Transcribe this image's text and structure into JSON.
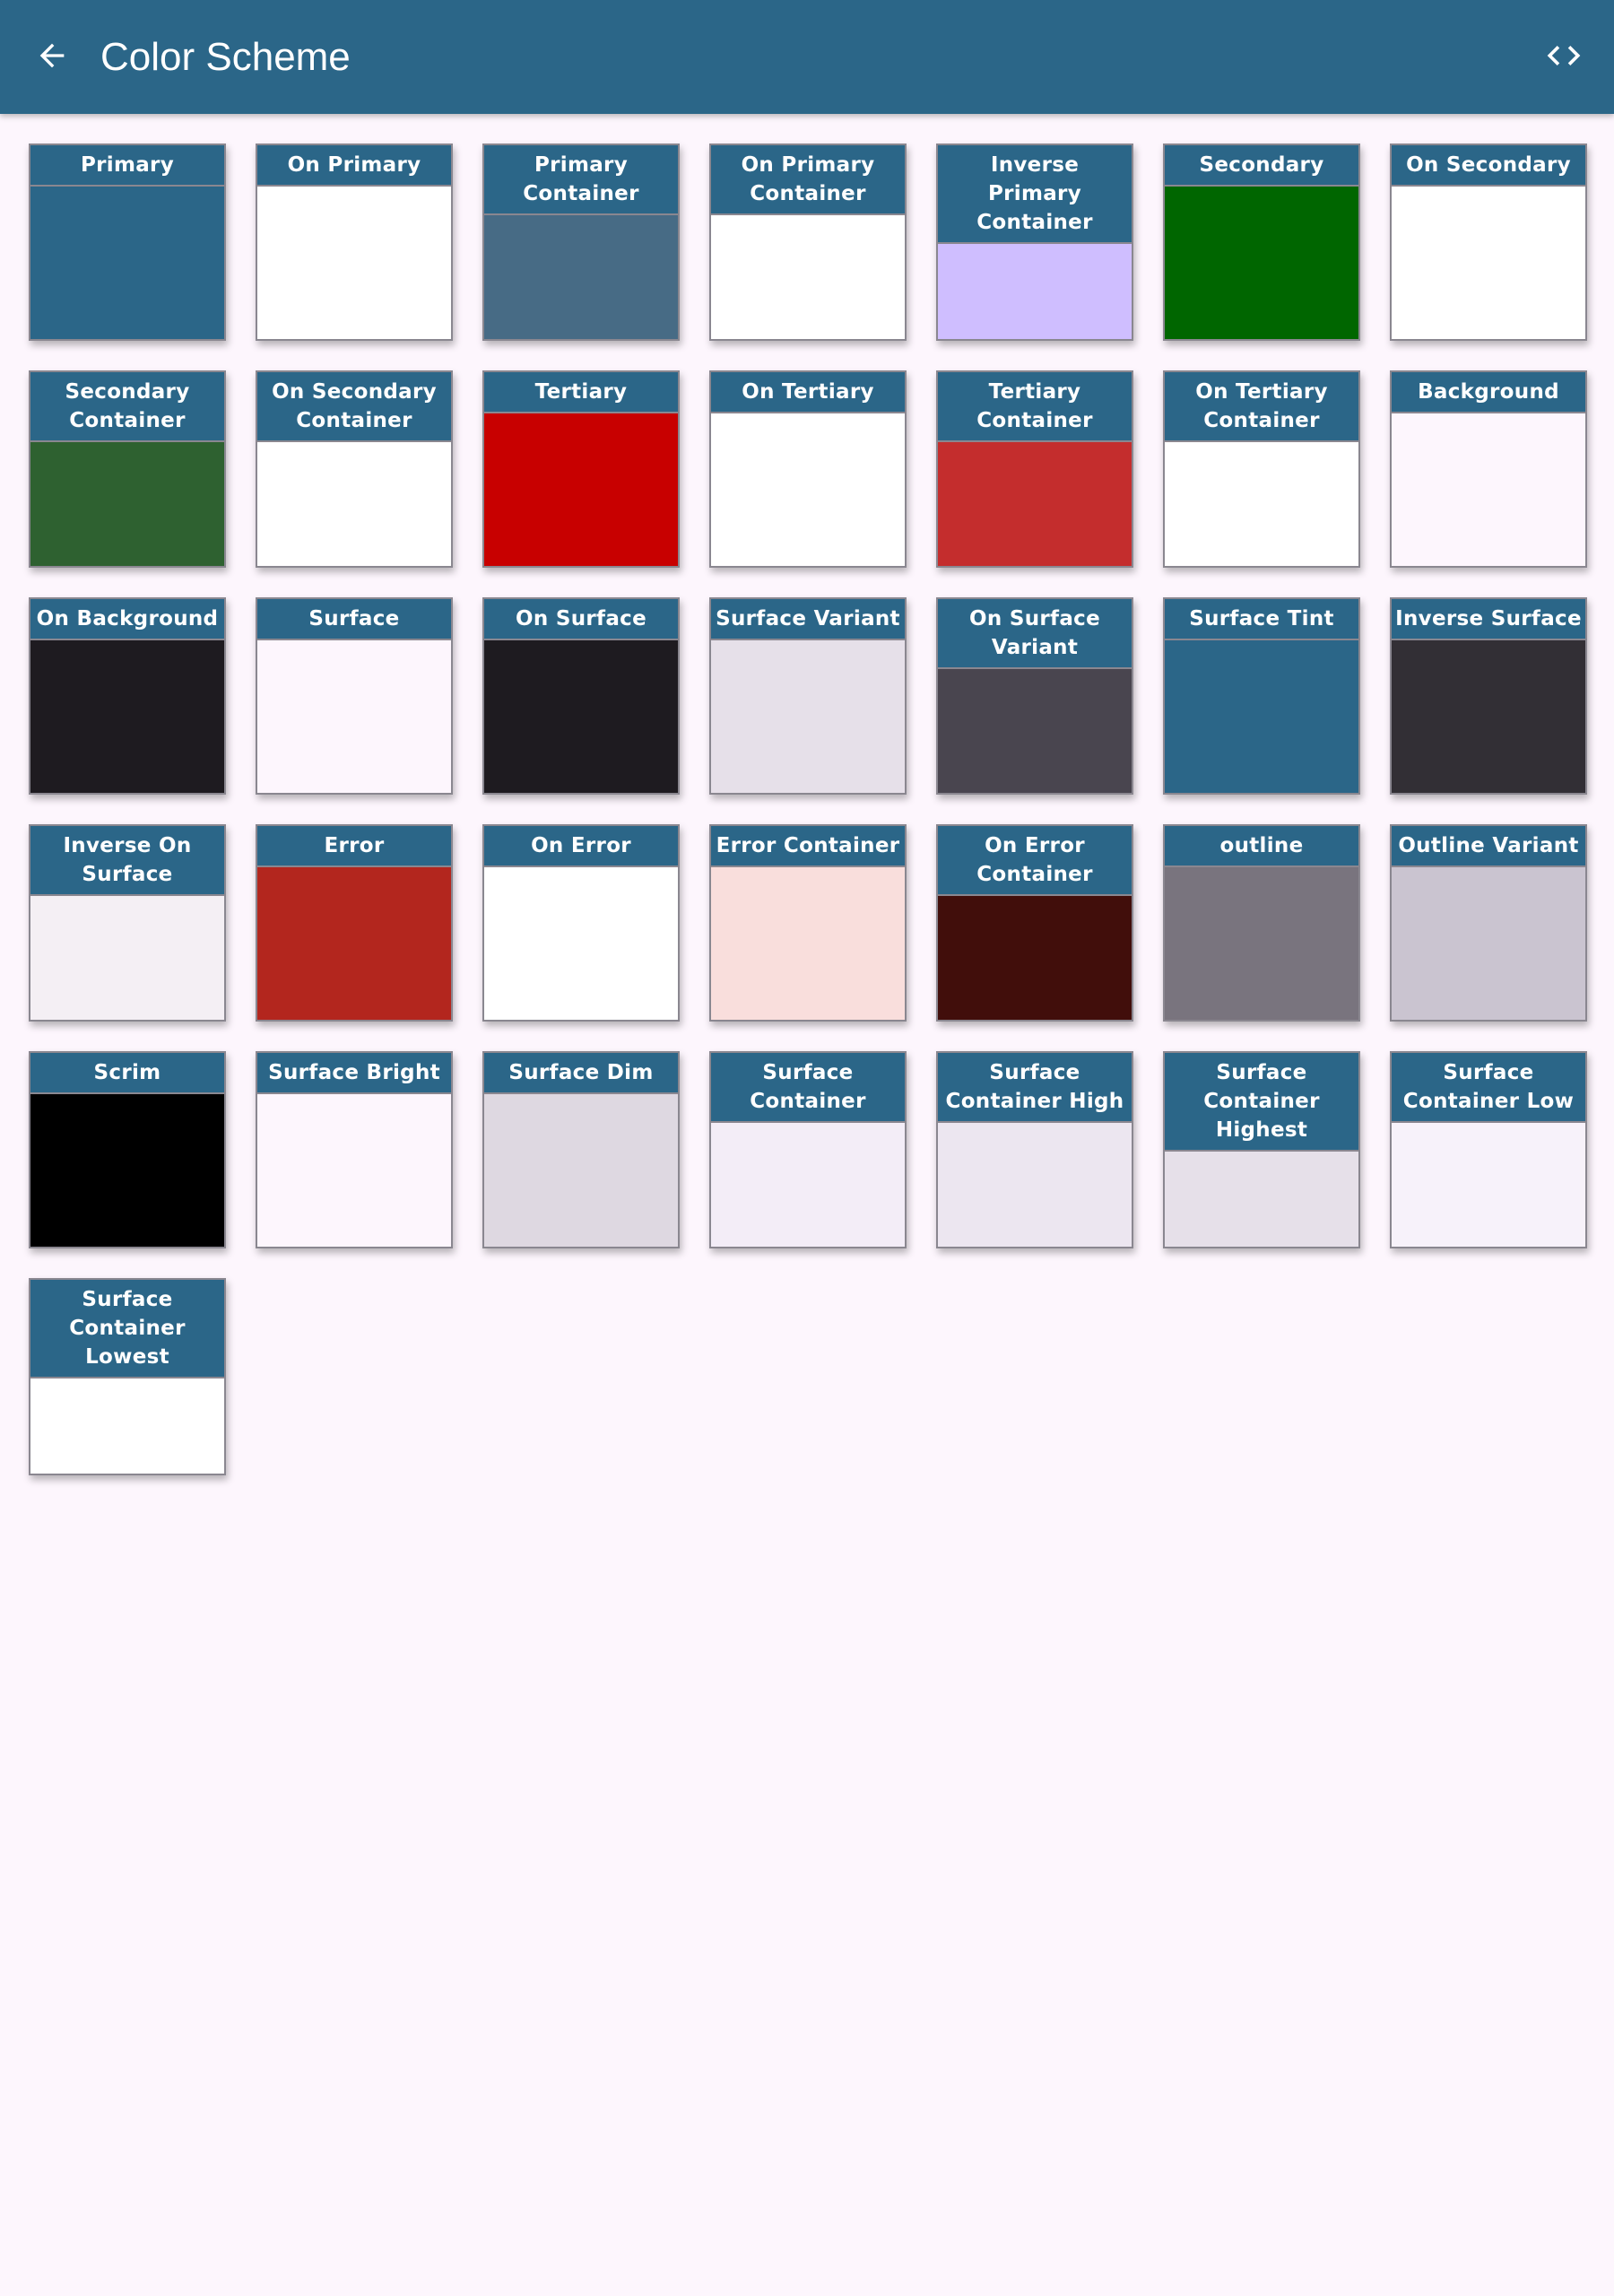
{
  "appbar": {
    "title": "Color Scheme",
    "back_icon": "arrow-back-icon",
    "code_icon": "code-icon",
    "background": "#2b6688"
  },
  "page": {
    "background": "#fdf6fd"
  },
  "swatches": [
    {
      "label": "Primary",
      "color": "#2b6688"
    },
    {
      "label": "On Primary",
      "color": "#ffffff"
    },
    {
      "label": "Primary\nContainer",
      "color": "#476b85"
    },
    {
      "label": "On Primary\nContainer",
      "color": "#ffffff"
    },
    {
      "label": "Inverse Primary\nContainer",
      "color": "#cfbeff"
    },
    {
      "label": "Secondary",
      "color": "#006600"
    },
    {
      "label": "On Secondary",
      "color": "#ffffff"
    },
    {
      "label": "Secondary\nContainer",
      "color": "#2e6130"
    },
    {
      "label": "On Secondary\nContainer",
      "color": "#ffffff"
    },
    {
      "label": "Tertiary",
      "color": "#c80000"
    },
    {
      "label": "On Tertiary",
      "color": "#ffffff"
    },
    {
      "label": "Tertiary\nContainer",
      "color": "#c42d2d"
    },
    {
      "label": "On Tertiary\nContainer",
      "color": "#ffffff"
    },
    {
      "label": "Background",
      "color": "#fdf6fd"
    },
    {
      "label": "On Background",
      "color": "#1e1b20"
    },
    {
      "label": "Surface",
      "color": "#fdf6fd"
    },
    {
      "label": "On Surface",
      "color": "#1e1b20"
    },
    {
      "label": "Surface Variant",
      "color": "#e6e0e9"
    },
    {
      "label": "On Surface\nVariant",
      "color": "#49454f"
    },
    {
      "label": "Surface Tint",
      "color": "#2b6688"
    },
    {
      "label": "Inverse Surface",
      "color": "#322f35"
    },
    {
      "label": "Inverse On\nSurface",
      "color": "#f4eff4"
    },
    {
      "label": "Error",
      "color": "#b3261e"
    },
    {
      "label": "On Error",
      "color": "#ffffff"
    },
    {
      "label": "Error Container",
      "color": "#f9dedc"
    },
    {
      "label": "On Error\nContainer",
      "color": "#410e0b"
    },
    {
      "label": "outline",
      "color": "#79747e"
    },
    {
      "label": "Outline Variant",
      "color": "#cac4d0"
    },
    {
      "label": "Scrim",
      "color": "#000000"
    },
    {
      "label": "Surface Bright",
      "color": "#fdf6fd"
    },
    {
      "label": "Surface Dim",
      "color": "#ded8e1"
    },
    {
      "label": "Surface\nContainer",
      "color": "#f3edf7"
    },
    {
      "label": "Surface\nContainer High",
      "color": "#ece6f0"
    },
    {
      "label": "Surface\nContainer\nHighest",
      "color": "#e6e0e9"
    },
    {
      "label": "Surface\nContainer Low",
      "color": "#f7f2fa"
    },
    {
      "label": "Surface\nContainer Lowest",
      "color": "#ffffff"
    }
  ]
}
